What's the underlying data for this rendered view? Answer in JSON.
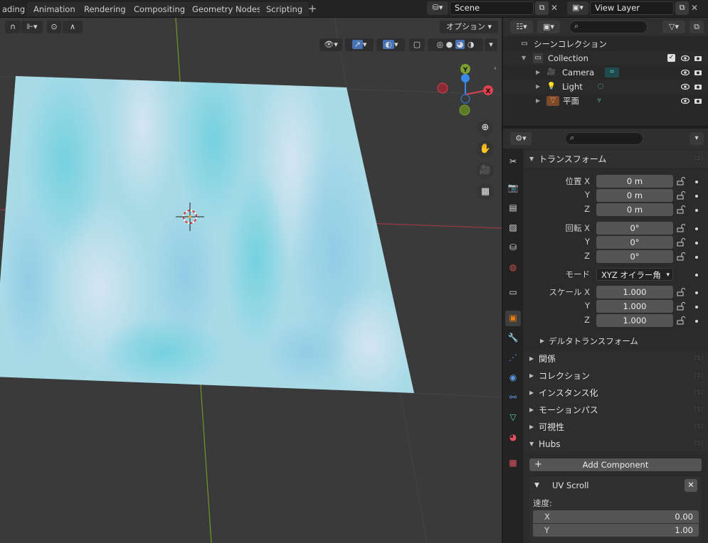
{
  "workspace_tabs": [
    "ading",
    "Animation",
    "Rendering",
    "Compositing",
    "Geometry Nodes",
    "Scripting"
  ],
  "scene": {
    "name": "Scene",
    "view_layer": "View Layer"
  },
  "viewport": {
    "options_label": "オプション",
    "gizmo_axes": {
      "x": "X",
      "y": "Y"
    }
  },
  "outliner": {
    "scene_collection": "シーンコレクション",
    "items": [
      {
        "label": "Collection"
      },
      {
        "label": "Camera"
      },
      {
        "label": "Light"
      },
      {
        "label": "平面"
      }
    ]
  },
  "properties": {
    "transform": {
      "title": "トランスフォーム",
      "location_label": "位置 X",
      "rotation_label": "回転 X",
      "scale_label": "スケール X",
      "y_label": "Y",
      "z_label": "Z",
      "location": [
        "0 m",
        "0 m",
        "0 m"
      ],
      "rotation": [
        "0°",
        "0°",
        "0°"
      ],
      "mode_label": "モード",
      "mode_value": "XYZ オイラー角",
      "scale": [
        "1.000",
        "1.000",
        "1.000"
      ],
      "delta_transform": "デルタトランスフォーム"
    },
    "panels": [
      "関係",
      "コレクション",
      "インスタンス化",
      "モーションパス",
      "可視性",
      "Hubs"
    ],
    "hubs": {
      "add_component": "Add Component",
      "component_title": "UV Scroll",
      "speed_label": "速度:",
      "speed_x_label": "X",
      "speed_y_label": "Y",
      "speed_x": "0.00",
      "speed_y": "1.00"
    }
  },
  "colors": {
    "plane_base": "#a7dbe6",
    "x_axis": "#e04050",
    "y_axis": "#7aa030",
    "z_axis": "#3a8ae8",
    "active_tab": "#e87d0d"
  }
}
